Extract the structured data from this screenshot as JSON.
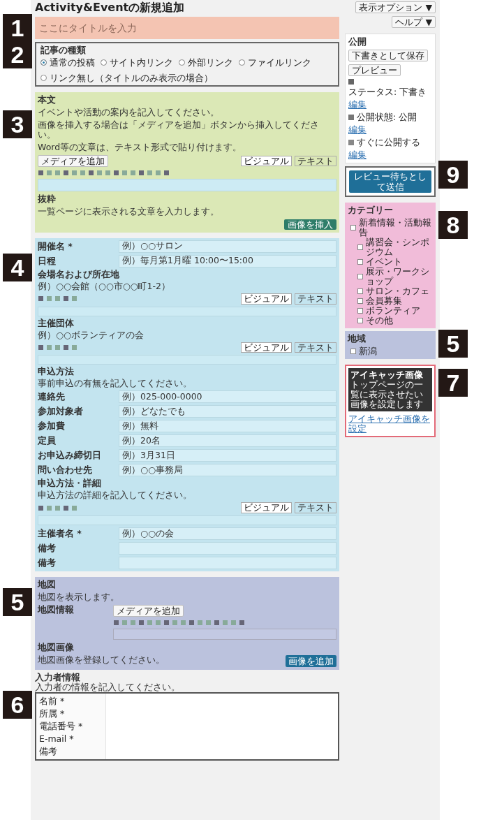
{
  "header_buttons": [
    {
      "label": "表示オプション ▼"
    },
    {
      "label": "ヘルプ ▼"
    }
  ],
  "page_title": "Activity&Eventの新規追加",
  "title_field": {
    "placeholder": "ここにタイトルを入力",
    "callout": "1"
  },
  "post_type": {
    "label": "記事の種類",
    "callout": "2",
    "options": [
      {
        "label": "通常の投稿",
        "selected": true
      },
      {
        "label": "サイト内リンク",
        "selected": false
      },
      {
        "label": "外部リンク",
        "selected": false
      },
      {
        "label": "ファイルリンク",
        "selected": false
      },
      {
        "label": "リンク無し（タイトルのみ表示の場合）",
        "selected": false
      }
    ]
  },
  "body_editor": {
    "label": "本文",
    "callout": "3",
    "description": [
      "イベントや活動の案内を記入してください。",
      "画像を挿入する場合は「メディアを追加」ボタンから挿入してください。",
      "Word等の文章は、テキスト形式で貼り付けます。"
    ],
    "media_button": "メディアを追加",
    "tabs": [
      {
        "label": "ビジュアル",
        "selected": true
      },
      {
        "label": "テキスト",
        "selected": false
      }
    ],
    "excerpt_label": "抜粋",
    "excerpt_text": "一覧ページに表示される文章を入力します。",
    "insert_button": "画像を挿入"
  },
  "event_fields": {
    "callout": "4",
    "fields": [
      {
        "kind": "input",
        "label": "開催名 *",
        "value": "例）○○サロン"
      },
      {
        "kind": "input",
        "label": "日程",
        "value": "例）毎月第1月曜 10:00〜15:00"
      },
      {
        "kind": "editor",
        "label": "会場名および所在地",
        "description": "例）○○会館（○○市○○町1-2）",
        "tabs": [
          {
            "label": "ビジュアル",
            "selected": true
          },
          {
            "label": "テキスト",
            "selected": false
          }
        ]
      },
      {
        "kind": "editor",
        "label": "主催団体",
        "description": "例）○○ボランティアの会",
        "tabs": [
          {
            "label": "ビジュアル",
            "selected": true
          },
          {
            "label": "テキスト",
            "selected": false
          }
        ]
      },
      {
        "kind": "note",
        "label": "申込方法",
        "description": "事前申込の有無を記入してください。"
      },
      {
        "kind": "input",
        "label": "連絡先",
        "value": "例）025-000-0000"
      },
      {
        "kind": "input",
        "label": "参加対象者",
        "value": "例）どなたでも"
      },
      {
        "kind": "input",
        "label": "参加費",
        "value": "例）無料"
      },
      {
        "kind": "input",
        "label": "定員",
        "value": "例）20名"
      },
      {
        "kind": "input",
        "label": "お申込み締切日",
        "value": "例）3月31日"
      },
      {
        "kind": "input",
        "label": "問い合わせ先",
        "value": "例）○○事務局"
      },
      {
        "kind": "editor",
        "label": "申込方法・詳細",
        "description": "申込方法の詳細を記入してください。",
        "tabs": [
          {
            "label": "ビジュアル",
            "selected": true
          },
          {
            "label": "テキスト",
            "selected": false
          }
        ]
      },
      {
        "kind": "input",
        "label": "主催者名 *",
        "value": "例）○○の会"
      },
      {
        "kind": "input",
        "label": "備考"
      },
      {
        "kind": "input",
        "label": "備考"
      }
    ]
  },
  "map_section": {
    "callout": "5",
    "label": "地図",
    "description": "地図を表示します。",
    "left_label": "地図情報",
    "media_button": "メディアを追加",
    "image_label": "地図画像",
    "image_description": "地図画像を登録してください。",
    "button": "画像を追加"
  },
  "submitter": {
    "callout": "6",
    "label": "入力者情報",
    "description": "入力者の情報を記入してください。",
    "rows": [
      {
        "label": "名前 *"
      },
      {
        "label": "所属 *"
      },
      {
        "label": "電話番号 *"
      },
      {
        "label": "E-mail *"
      },
      {
        "label": "備考"
      }
    ]
  },
  "publish_box": {
    "title": "公開",
    "save_button": "下書きとして保存",
    "preview_button": "プレビュー",
    "rows": [
      {
        "kind": "status",
        "text": "ステータス: 下書き",
        "link": "編集"
      },
      {
        "kind": "visibility",
        "text": "公開状態: 公開",
        "link": "編集"
      },
      {
        "kind": "schedule",
        "text": "すぐに公開する",
        "link": "編集"
      }
    ],
    "submit_button": "レビュー待ちとして送信",
    "callout": "9"
  },
  "categories": {
    "title": "カテゴリー",
    "callout": "8",
    "items": [
      {
        "label": "新着情報・活動報告",
        "checked": false,
        "children": [
          {
            "label": "講習会・シンポジウム",
            "checked": false
          },
          {
            "label": "イベント",
            "checked": false
          },
          {
            "label": "展示・ワークショップ",
            "checked": false
          },
          {
            "label": "サロン・カフェ",
            "checked": false
          },
          {
            "label": "会員募集",
            "checked": false
          },
          {
            "label": "ボランティア",
            "checked": false
          },
          {
            "label": "その他",
            "checked": false
          }
        ]
      }
    ]
  },
  "region": {
    "title": "地域",
    "callout": "5",
    "items": [
      {
        "label": "新潟",
        "checked": false
      }
    ]
  },
  "featured_image": {
    "title": "アイキャッチ画像",
    "tooltip": "トップページの一覧に表示させたい画像を設定します",
    "link": "アイキャッチ画像を設定",
    "callout": "7"
  }
}
